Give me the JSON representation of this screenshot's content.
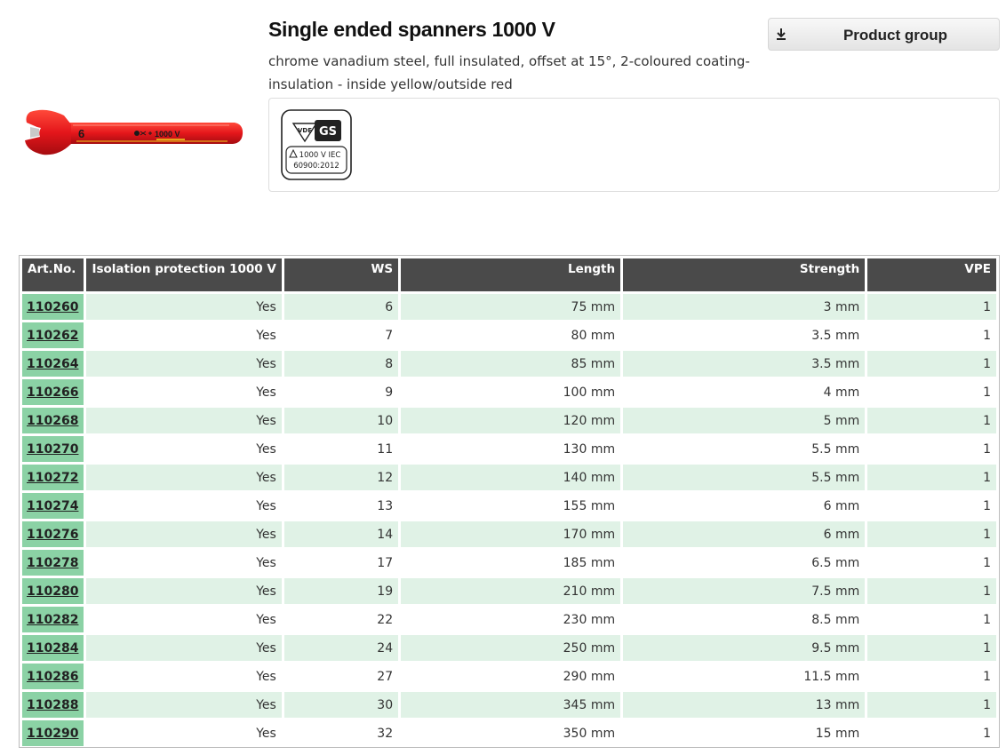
{
  "product": {
    "title": "Single ended spanners 1000 V",
    "description": "chrome vanadium steel, full insulated, offset at 15°, 2-coloured coating-insulation - inside yellow/outside red",
    "image_size_label": "6",
    "image_voltage_label": "1000 V",
    "image_name": "insulated-spanner-image"
  },
  "product_group_button": {
    "label": "Product group",
    "icon": "download-icon"
  },
  "certification": {
    "top_marks": "VDE GS",
    "vde_mark": "VDE",
    "gs_mark": "GS",
    "voltage_line": "1000 V IEC",
    "standard_line": "60900:2012"
  },
  "table": {
    "headers": {
      "artno": "Art.No.",
      "isolation": "Isolation protection 1000 V",
      "ws": "WS",
      "length": "Length",
      "strength": "Strength",
      "vpe": "VPE"
    },
    "rows": [
      {
        "artno": "110260",
        "isolation": "Yes",
        "ws": "6",
        "length": "75 mm",
        "strength": "3 mm",
        "vpe": "1"
      },
      {
        "artno": "110262",
        "isolation": "Yes",
        "ws": "7",
        "length": "80 mm",
        "strength": "3.5 mm",
        "vpe": "1"
      },
      {
        "artno": "110264",
        "isolation": "Yes",
        "ws": "8",
        "length": "85 mm",
        "strength": "3.5 mm",
        "vpe": "1"
      },
      {
        "artno": "110266",
        "isolation": "Yes",
        "ws": "9",
        "length": "100 mm",
        "strength": "4 mm",
        "vpe": "1"
      },
      {
        "artno": "110268",
        "isolation": "Yes",
        "ws": "10",
        "length": "120 mm",
        "strength": "5 mm",
        "vpe": "1"
      },
      {
        "artno": "110270",
        "isolation": "Yes",
        "ws": "11",
        "length": "130 mm",
        "strength": "5.5 mm",
        "vpe": "1"
      },
      {
        "artno": "110272",
        "isolation": "Yes",
        "ws": "12",
        "length": "140 mm",
        "strength": "5.5 mm",
        "vpe": "1"
      },
      {
        "artno": "110274",
        "isolation": "Yes",
        "ws": "13",
        "length": "155 mm",
        "strength": "6 mm",
        "vpe": "1"
      },
      {
        "artno": "110276",
        "isolation": "Yes",
        "ws": "14",
        "length": "170 mm",
        "strength": "6 mm",
        "vpe": "1"
      },
      {
        "artno": "110278",
        "isolation": "Yes",
        "ws": "17",
        "length": "185 mm",
        "strength": "6.5 mm",
        "vpe": "1"
      },
      {
        "artno": "110280",
        "isolation": "Yes",
        "ws": "19",
        "length": "210 mm",
        "strength": "7.5 mm",
        "vpe": "1"
      },
      {
        "artno": "110282",
        "isolation": "Yes",
        "ws": "22",
        "length": "230 mm",
        "strength": "8.5 mm",
        "vpe": "1"
      },
      {
        "artno": "110284",
        "isolation": "Yes",
        "ws": "24",
        "length": "250 mm",
        "strength": "9.5 mm",
        "vpe": "1"
      },
      {
        "artno": "110286",
        "isolation": "Yes",
        "ws": "27",
        "length": "290 mm",
        "strength": "11.5 mm",
        "vpe": "1"
      },
      {
        "artno": "110288",
        "isolation": "Yes",
        "ws": "30",
        "length": "345 mm",
        "strength": "13 mm",
        "vpe": "1"
      },
      {
        "artno": "110290",
        "isolation": "Yes",
        "ws": "32",
        "length": "350 mm",
        "strength": "15 mm",
        "vpe": "1"
      }
    ]
  },
  "colors": {
    "header_bg": "#4a4a4a",
    "artno_bg": "#8bd2a5",
    "row_stripe": "#e0f2e6",
    "spanner_red": "#e4161b",
    "spanner_yellow": "#f4d21e"
  }
}
